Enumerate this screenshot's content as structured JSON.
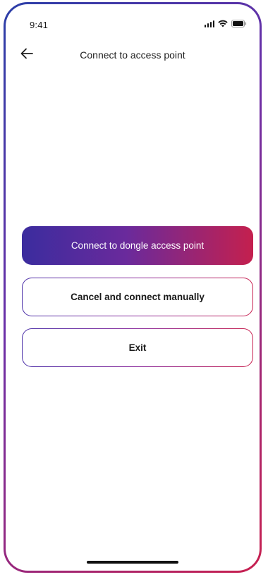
{
  "status_bar": {
    "time": "9:41"
  },
  "header": {
    "title": "Connect to access point",
    "back_icon": "arrow-left-icon"
  },
  "actions": {
    "primary_label": "Connect to dongle access point",
    "cancel_label": "Cancel and connect manually",
    "exit_label": "Exit"
  },
  "colors": {
    "gradient_start": "#3b2c9e",
    "gradient_mid": "#6a2a9c",
    "gradient_end": "#c4204e",
    "text": "#1a1a1a",
    "background": "#ffffff"
  }
}
